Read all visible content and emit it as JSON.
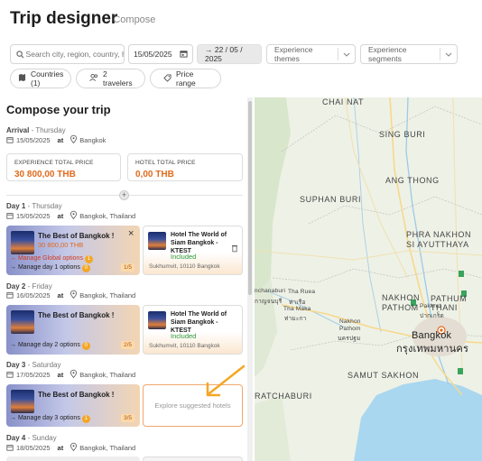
{
  "header": {
    "title": "Trip designer",
    "breadcrumb": "Compose"
  },
  "filters": {
    "search_placeholder": "Search city, region, country, hotel",
    "date_from": "15/05/2025",
    "date_to": "→ 22 / 05 / 2025",
    "themes_label": "Experience themes",
    "segments_label": "Experience segments",
    "countries_label": "Countries (1)",
    "travelers_label": "2 travelers",
    "price_range_label": "Price range"
  },
  "compose": {
    "title": "Compose your trip",
    "arrival": {
      "label": "Arrival",
      "weekday": "Thursday",
      "date": "15/05/2025",
      "at": "at",
      "place": "Bangkok"
    },
    "experience_total": {
      "label": "EXPERIENCE TOTAL PRICE",
      "value": "30 800,00 THB"
    },
    "hotel_total": {
      "label": "HOTEL TOTAL PRICE",
      "value": "0,00 THB"
    },
    "days": [
      {
        "label": "Day 1",
        "weekday": "Thursday",
        "date": "15/05/2025",
        "at": "at",
        "place": "Bangkok, Thailand",
        "experience": {
          "title": "The Best of Bangkok !",
          "price": "30 800,00 THB",
          "manage_global": "→ Manage Global options",
          "global_count": "1",
          "manage_day": "→ Manage day 1 options",
          "day_count": "0",
          "counter": "1/5"
        },
        "hotel": {
          "name": "Hotel The World of Siam Bangkok - KTEST",
          "status": "Included",
          "address": "Sukhumvit, 10110 Bangkok"
        }
      },
      {
        "label": "Day 2",
        "weekday": "Friday",
        "date": "16/05/2025",
        "at": "at",
        "place": "Bangkok, Thailand",
        "experience": {
          "title": "The Best of Bangkok !",
          "manage_day": "→ Manage day 2 options",
          "day_count": "0",
          "counter": "2/5"
        },
        "hotel": {
          "name": "Hotel The World of Siam Bangkok - KTEST",
          "status": "Included",
          "address": "Sukhumvit, 10110 Bangkok"
        }
      },
      {
        "label": "Day 3",
        "weekday": "Saturday",
        "date": "17/05/2025",
        "at": "at",
        "place": "Bangkok, Thailand",
        "experience": {
          "title": "The Best of Bangkok !",
          "manage_day": "→ Manage day 3 options",
          "day_count": "1",
          "counter": "3/5"
        },
        "explore_label": "Explore suggested hotels"
      },
      {
        "label": "Day 4",
        "weekday": "Sunday",
        "date": "18/05/2025",
        "at": "at",
        "place": "Bangkok, Thailand"
      }
    ]
  },
  "map": {
    "labels": {
      "chai_nat": "CHAI NAT",
      "sing_buri": "SING BURI",
      "ang_thong": "ANG THONG",
      "suphan_buri": "SUPHAN BURI",
      "phra_nakhon": "PHRA NAKHON",
      "si_ayutthaya": "SI AYUTTHAYA",
      "nakhon": "NAKHON",
      "pathom": "PATHOM",
      "pathum_thani": "PATHUM THANI",
      "kanchanaburi": "nchanaburi",
      "tha_ruea": "Tha Ruea",
      "tha_ruea_th": "ท่าเรือ",
      "kanchanaburi_th": "กาญจนบุรี",
      "tha_maka": "Tha Maka",
      "tha_maka_th": "ท่ามะกา",
      "nakhon_pathom_city": "Nakhon",
      "nakhon_pathom_city2": "Pathom",
      "nakhon_pathom_th": "นครปฐม",
      "pak_kret": "Pakkret",
      "pak_kret_th": "ปากเกร็ด",
      "bangkok": "Bangkok",
      "bangkok_th": "กรุงเทพมหานคร",
      "samut_sakhon": "SAMUT SAKHON",
      "ratchaburi": "RATCHABURI",
      "route_9": "9",
      "route_4": "4"
    }
  },
  "colors": {
    "accent": "#e16a1c",
    "included": "#2b9a3b",
    "arrow": "#f5a623"
  }
}
